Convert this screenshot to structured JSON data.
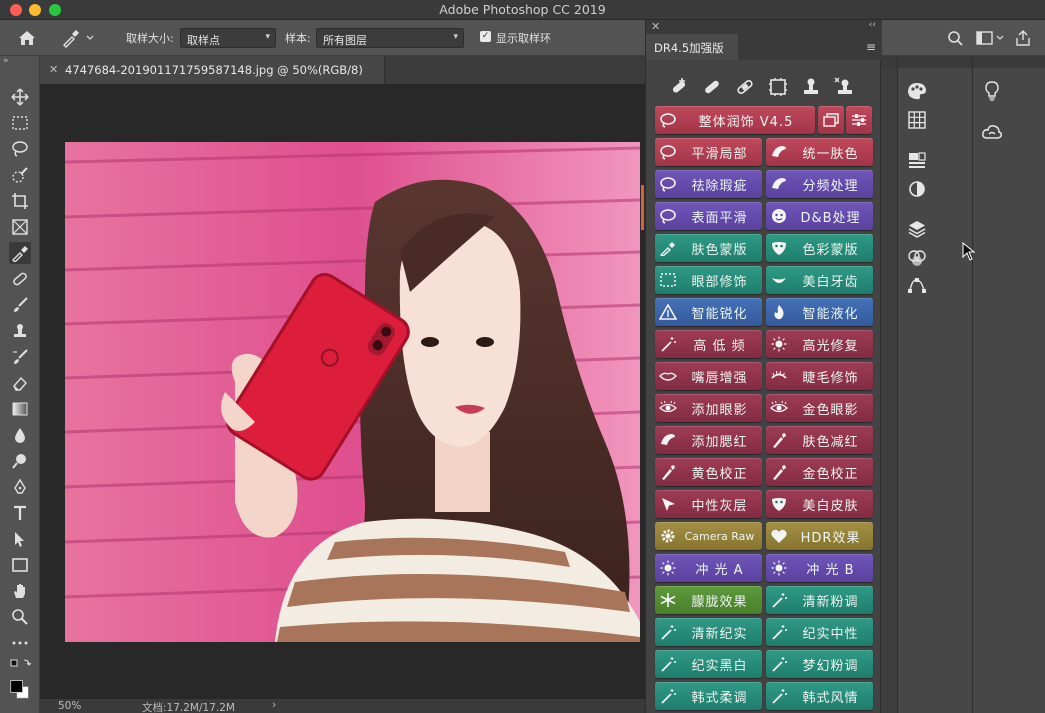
{
  "window": {
    "title": "Adobe Photoshop CC 2019"
  },
  "options_bar": {
    "sample_size_label": "取样大小:",
    "sample_size_value": "取样点",
    "sample_label": "样本:",
    "sample_value": "所有图层",
    "show_ring_label": "显示取样环",
    "show_ring_checked": true
  },
  "document": {
    "tab_name": "4747684-20190117175958714​8.jpg @ 50%(RGB/8)",
    "zoom": "50%",
    "doc_size": "文档:17.2M/17.2M"
  },
  "plugin_panel": {
    "tab": "DR4.5加强版",
    "rows": [
      [
        {
          "label": "整体润饰  V4.5",
          "color": "red",
          "icon": "lasso-icon"
        }
      ],
      [
        {
          "label": "平滑局部",
          "color": "red",
          "icon": "lasso-icon"
        },
        {
          "label": "统一肤色",
          "color": "red",
          "icon": "hand-brush-icon"
        }
      ],
      [
        {
          "label": "祛除瑕疵",
          "color": "purple",
          "icon": "lasso-icon"
        },
        {
          "label": "分频处理",
          "color": "purple",
          "icon": "hand-brush-icon"
        }
      ],
      [
        {
          "label": "表面平滑",
          "color": "purple",
          "icon": "lasso-icon"
        },
        {
          "label": "D&B处理",
          "color": "purple",
          "icon": "face-icon"
        }
      ],
      [
        {
          "label": "肤色蒙版",
          "color": "teal",
          "icon": "eyedropper-icon"
        },
        {
          "label": "色彩蒙版",
          "color": "teal",
          "icon": "mask-icon"
        }
      ],
      [
        {
          "label": "眼部修饰",
          "color": "teal",
          "icon": "marquee-icon"
        },
        {
          "label": "美白牙齿",
          "color": "teal",
          "icon": "smile-icon"
        }
      ],
      [
        {
          "label": "智能锐化",
          "color": "blue",
          "icon": "triangle-icon"
        },
        {
          "label": "智能液化",
          "color": "blue",
          "icon": "flame-icon"
        }
      ],
      [
        {
          "label": "高 低 频",
          "color": "maroon",
          "icon": "wand-icon"
        },
        {
          "label": "高光修复",
          "color": "maroon",
          "icon": "sun-icon"
        }
      ],
      [
        {
          "label": "嘴唇增强",
          "color": "maroon",
          "icon": "lips-icon"
        },
        {
          "label": "睫毛修饰",
          "color": "maroon",
          "icon": "lash-icon"
        }
      ],
      [
        {
          "label": "添加眼影",
          "color": "maroon",
          "icon": "eye-icon"
        },
        {
          "label": "金色眼影",
          "color": "maroon",
          "icon": "eye-icon"
        }
      ],
      [
        {
          "label": "添加腮红",
          "color": "maroon",
          "icon": "hand-brush-icon"
        },
        {
          "label": "肤色减红",
          "color": "maroon",
          "icon": "dropper-icon"
        }
      ],
      [
        {
          "label": "黄色校正",
          "color": "maroon",
          "icon": "dropper-icon"
        },
        {
          "label": "金色校正",
          "color": "maroon",
          "icon": "dropper-icon"
        }
      ],
      [
        {
          "label": "中性灰层",
          "color": "maroon",
          "icon": "cursor-icon"
        },
        {
          "label": "美白皮肤",
          "color": "maroon",
          "icon": "mask-icon"
        }
      ],
      [
        {
          "label": "Camera Raw",
          "color": "olive",
          "icon": "gear-icon"
        },
        {
          "label": "HDR效果",
          "color": "olive",
          "icon": "heart-icon"
        }
      ],
      [
        {
          "label": "冲 光 A",
          "color": "purple",
          "icon": "sun-icon"
        },
        {
          "label": "冲 光 B",
          "color": "purple",
          "icon": "sun-icon"
        }
      ],
      [
        {
          "label": "朦胧效果",
          "color": "green",
          "icon": "snow-icon"
        },
        {
          "label": "清新粉调",
          "color": "teal",
          "icon": "wand-icon"
        }
      ],
      [
        {
          "label": "清新纪实",
          "color": "teal",
          "icon": "wand-icon"
        },
        {
          "label": "纪实中性",
          "color": "teal",
          "icon": "wand-icon"
        }
      ],
      [
        {
          "label": "纪实黑白",
          "color": "teal",
          "icon": "wand-icon"
        },
        {
          "label": "梦幻粉调",
          "color": "teal",
          "icon": "wand-icon"
        }
      ],
      [
        {
          "label": "韩式柔调",
          "color": "teal",
          "icon": "wand-icon"
        },
        {
          "label": "韩式风情",
          "color": "teal",
          "icon": "wand-icon"
        }
      ]
    ]
  }
}
